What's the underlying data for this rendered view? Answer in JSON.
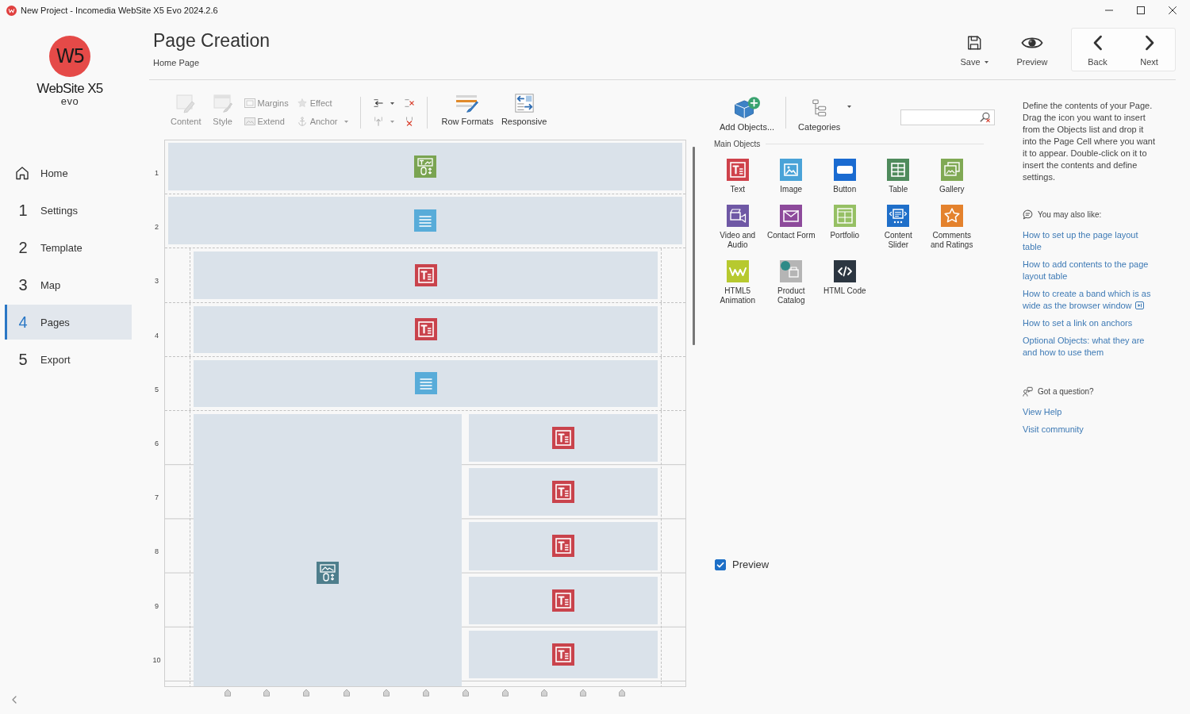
{
  "window": {
    "title": "New Project - Incomedia WebSite X5 Evo 2024.2.6"
  },
  "sidebar": {
    "logo": {
      "mark": "W5",
      "name": "WebSite X5",
      "edition": "evo"
    },
    "nav": [
      {
        "kind": "home",
        "label": "Home",
        "selected": false
      },
      {
        "kind": "step",
        "number": "1",
        "label": "Settings",
        "selected": false
      },
      {
        "kind": "step",
        "number": "2",
        "label": "Template",
        "selected": false
      },
      {
        "kind": "step",
        "number": "3",
        "label": "Map",
        "selected": false
      },
      {
        "kind": "step",
        "number": "4",
        "label": "Pages",
        "selected": true
      },
      {
        "kind": "step",
        "number": "5",
        "label": "Export",
        "selected": false
      }
    ]
  },
  "header": {
    "title": "Page Creation",
    "subtitle": "Home Page",
    "actions": [
      {
        "label": "Save",
        "dropdown": true
      },
      {
        "label": "Preview",
        "dropdown": false
      }
    ],
    "navigation": [
      {
        "label": "Back"
      },
      {
        "label": "Next"
      }
    ]
  },
  "toolbar": {
    "sections": [
      {
        "groups": [
          {
            "kind": "large",
            "items": [
              {
                "label": "Content",
                "disabled": true,
                "dropdown": false
              },
              {
                "label": "Style",
                "disabled": true,
                "dropdown": false
              }
            ]
          },
          {
            "kind": "stack",
            "items": [
              {
                "label": "Margins",
                "disabled": true,
                "dropdown": false
              },
              {
                "label": "Extend",
                "disabled": true,
                "dropdown": false
              },
              {
                "label": "Effect",
                "disabled": true,
                "dropdown": false
              },
              {
                "label": "Anchor",
                "disabled": true,
                "dropdown": true
              }
            ]
          }
        ]
      },
      {
        "groups": [
          {
            "kind": "stack",
            "items": [
              {
                "disabled": false,
                "dropdown": true
              },
              {
                "disabled": true,
                "dropdown": true
              },
              {
                "disabled": false,
                "dropdown": false
              },
              {
                "disabled": false,
                "dropdown": false
              }
            ]
          }
        ]
      },
      {
        "groups": [
          {
            "kind": "large",
            "items": [
              {
                "label": "Row Formats",
                "disabled": false,
                "dropdown": false
              },
              {
                "label": "Responsive",
                "disabled": false,
                "dropdown": false
              }
            ]
          }
        ]
      }
    ]
  },
  "canvas": {
    "row_numbers": [
      "1",
      "2",
      "3",
      "4",
      "5",
      "6",
      "7",
      "8",
      "9",
      "10"
    ],
    "blocks": [
      {
        "kind": "band",
        "cell": {
          "kind": "mixed"
        }
      },
      {
        "kind": "band",
        "cell": {
          "kind": "list"
        }
      },
      {
        "kind": "row",
        "cell": {
          "kind": "text"
        }
      },
      {
        "kind": "row",
        "cell": {
          "kind": "text"
        }
      },
      {
        "kind": "row",
        "cell": {
          "kind": "list"
        }
      },
      {
        "kind": "split",
        "left": {
          "kind": "picture"
        },
        "right": [
          {
            "kind": "text"
          },
          {
            "kind": "text"
          },
          {
            "kind": "text"
          },
          {
            "kind": "text"
          },
          {
            "kind": "text"
          }
        ]
      }
    ]
  },
  "objects_panel": {
    "toolbar": [
      {
        "label": "Add Objects...",
        "dropdown": false
      },
      {
        "label": "Categories",
        "dropdown": true
      }
    ],
    "section_title": "Main Objects",
    "objects": [
      {
        "label": "Text",
        "color": "#cf424b"
      },
      {
        "label": "Image",
        "color": "#4aa3d8"
      },
      {
        "label": "Button",
        "color": "#1a6bd1"
      },
      {
        "label": "Table",
        "color": "#4f8b5c"
      },
      {
        "label": "Gallery",
        "color": "#80a954"
      },
      {
        "label": "Video and Audio",
        "color": "#6f58a5"
      },
      {
        "label": "Contact Form",
        "color": "#8d4a9b"
      },
      {
        "label": "Portfolio",
        "color": "#96c064"
      },
      {
        "label": "Content Slider",
        "color": "#1f6fc9"
      },
      {
        "label": "Comments and Ratings",
        "color": "#e4822d"
      },
      {
        "label": "HTML5 Animation",
        "color": "#b7c92f"
      },
      {
        "label": "Product Catalog",
        "color": "#b5b5b5"
      },
      {
        "label": "HTML Code",
        "color": "#2c3641"
      }
    ],
    "preview": {
      "label": "Preview",
      "checked": true
    }
  },
  "help": {
    "intro": "Define the contents of your Page. Drag the icon you want to insert from the Objects list and drop it into the Page Cell where you want it to appear. Double-click on it to insert the contents and define settings.",
    "suggestions": {
      "title": "You may also like:",
      "links": [
        {
          "label": "How to set up the page layout table",
          "video": false
        },
        {
          "label": "How to add contents to the page layout table",
          "video": false
        },
        {
          "label": "How to create a band which is as wide as the browser window",
          "video": true
        },
        {
          "label": "How to set a link on anchors",
          "video": false
        },
        {
          "label": "Optional Objects: what they are and how to use them",
          "video": false
        }
      ]
    },
    "support": {
      "title": "Got a question?",
      "links": [
        "View Help",
        "Visit community"
      ]
    }
  }
}
